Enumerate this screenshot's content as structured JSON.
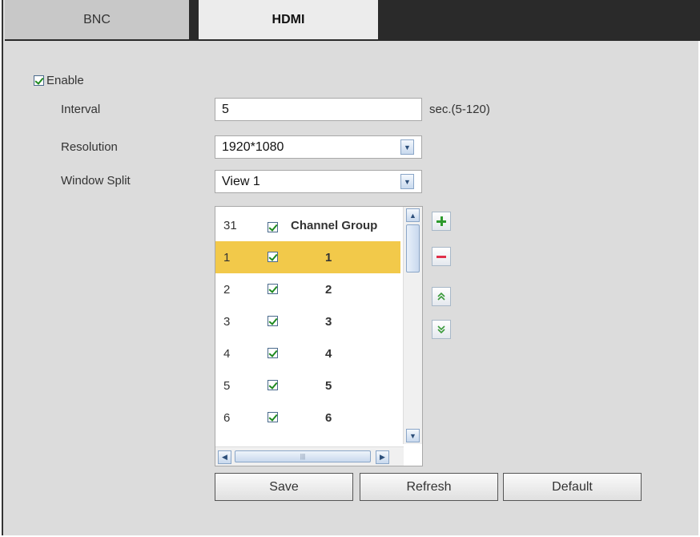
{
  "tabs": [
    {
      "label": "BNC",
      "active": false
    },
    {
      "label": "HDMI",
      "active": true
    }
  ],
  "enable": {
    "label": "Enable",
    "checked": true
  },
  "interval": {
    "label": "Interval",
    "value": "5",
    "hint": "sec.(5-120)"
  },
  "resolution": {
    "label": "Resolution",
    "value": "1920*1080"
  },
  "window_split": {
    "label": "Window Split",
    "value": "View 1"
  },
  "channel_list": {
    "header": {
      "count": "31",
      "label": "Channel Group",
      "checked": true
    },
    "rows": [
      {
        "num": "1",
        "group": "1",
        "checked": true,
        "selected": true
      },
      {
        "num": "2",
        "group": "2",
        "checked": true,
        "selected": false
      },
      {
        "num": "3",
        "group": "3",
        "checked": true,
        "selected": false
      },
      {
        "num": "4",
        "group": "4",
        "checked": true,
        "selected": false
      },
      {
        "num": "5",
        "group": "5",
        "checked": true,
        "selected": false
      },
      {
        "num": "6",
        "group": "6",
        "checked": true,
        "selected": false
      }
    ]
  },
  "side_buttons": [
    {
      "name": "add-icon"
    },
    {
      "name": "remove-icon"
    },
    {
      "name": "move-up-icon"
    },
    {
      "name": "move-down-icon"
    }
  ],
  "buttons": {
    "save": "Save",
    "refresh": "Refresh",
    "default": "Default"
  },
  "colors": {
    "selected_row": "#f2c94a",
    "add": "#2e9a2e",
    "remove": "#e0304a",
    "arrows": "#3a9a3a"
  }
}
